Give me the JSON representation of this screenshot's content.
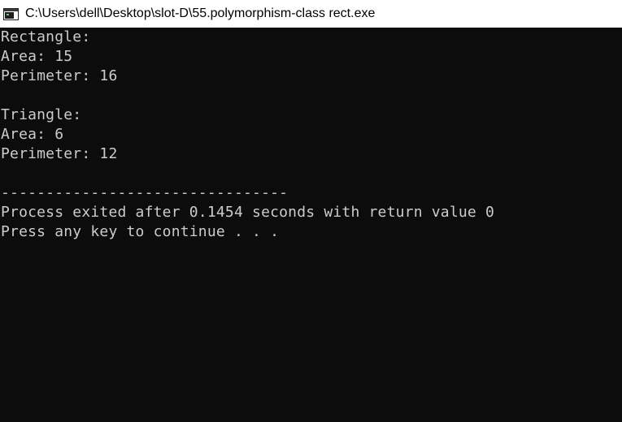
{
  "window": {
    "title": "C:\\Users\\dell\\Desktop\\slot-D\\55.polymorphism-class rect.exe",
    "icon": "console-app-icon"
  },
  "console": {
    "lines": [
      "Rectangle:",
      "Area: 15",
      "Perimeter: 16",
      "",
      "Triangle:",
      "Area: 6",
      "Perimeter: 12",
      "",
      "--------------------------------",
      "Process exited after 0.1454 seconds with return value 0",
      "Press any key to continue . . ."
    ]
  },
  "colors": {
    "background": "#0c0c0c",
    "text": "#cccccc",
    "titlebar": "#ffffff"
  }
}
